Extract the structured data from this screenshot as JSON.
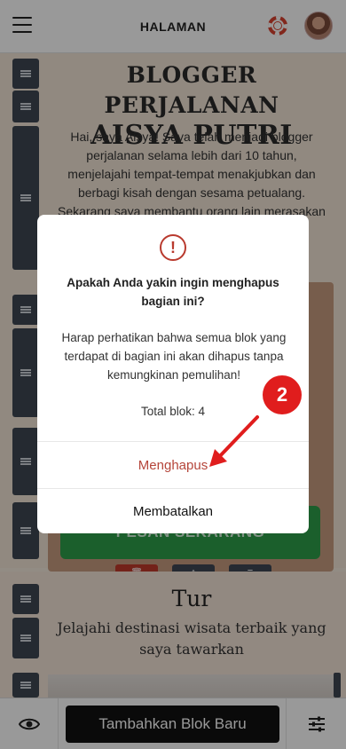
{
  "topbar": {
    "title": "HALAMAN",
    "menu_icon": "hamburger-menu-icon",
    "help_icon": "lifebuoy-icon",
    "avatar_icon": "user-avatar"
  },
  "hero": {
    "title_line1": "BLOGGER PERJALANAN",
    "title_line2": "AISYA PUTRI",
    "text": "Hai, saya Aisya! Saya telah menjadi blogger perjalanan selama lebih dari 10 tahun, menjelajahi tempat-tempat menakjubkan dan berbagi kisah dengan sesama petualang. Sekarang saya membantu orang lain merasakan",
    "cta": "PESAN SEKARANG"
  },
  "section_tools": {
    "delete_icon": "trash-icon",
    "move_icon": "move-vertical-icon",
    "drag_icon": "drag-handle-icon"
  },
  "tur": {
    "title": "Tur",
    "subtitle": "Jelajahi destinasi wisata terbaik yang saya tawarkan"
  },
  "bottombar": {
    "preview_icon": "eye-icon",
    "add_label": "Tambahkan Blok Baru",
    "settings_icon": "sliders-icon"
  },
  "modal": {
    "icon": "alert-circle-icon",
    "title": "Apakah Anda yakin ingin menghapus bagian ini?",
    "body": "Harap perhatikan bahwa semua blok yang terdapat di bagian ini akan dihapus tanpa kemungkinan pemulihan!",
    "count": "Total blok: 4",
    "confirm_label": "Menghapus",
    "cancel_label": "Membatalkan"
  },
  "annotation": {
    "step": "2"
  },
  "colors": {
    "danger": "#b5453a",
    "badge": "#e01d1d",
    "accent_green": "#2e9e4a"
  }
}
